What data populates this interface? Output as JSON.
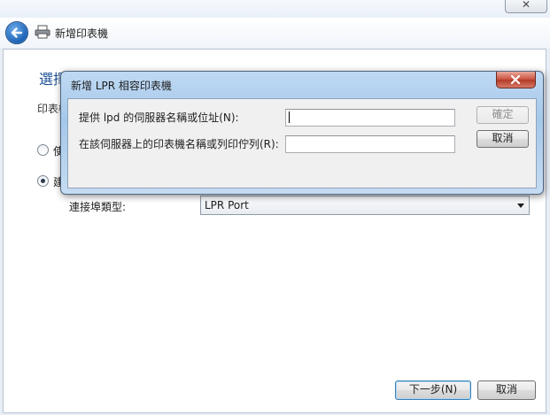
{
  "window": {
    "title": "新增印表機",
    "close_glyph": "✕",
    "back_icon": "back-arrow-icon",
    "printer_icon": "printer-icon"
  },
  "wizard": {
    "heading": "選擇一個印表機連接埠",
    "sub_text": "印表機",
    "radio_use_existing_label": "使",
    "radio_create_new_label": "建",
    "selected_option": "create_new",
    "port_type_label": "連接埠類型:",
    "port_type_value": "LPR Port",
    "next_button": "下一步(N)",
    "cancel_button": "取消"
  },
  "dialog": {
    "title": "新增 LPR 相容印表機",
    "server_label": "提供 lpd 的伺服器名稱或位址(N):",
    "server_value": "",
    "queue_label": "在該伺服器上的印表機名稱或列印佇列(R):",
    "queue_value": "",
    "ok_button": "確定",
    "ok_enabled": false,
    "cancel_button": "取消"
  },
  "colors": {
    "heading": "#1d4f95",
    "dialog_frame": "#a5c8ea",
    "close_red": "#c9503d"
  }
}
